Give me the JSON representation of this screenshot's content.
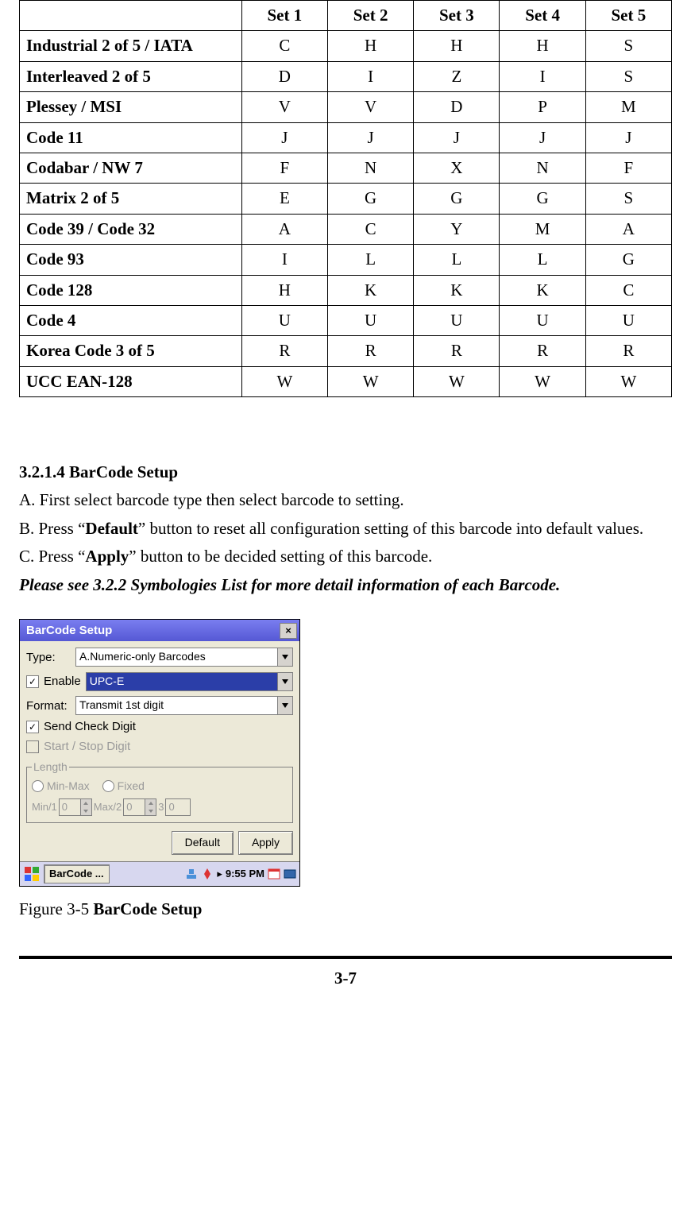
{
  "table": {
    "headers": [
      "",
      "Set 1",
      "Set 2",
      "Set 3",
      "Set 4",
      "Set 5"
    ],
    "rows": [
      {
        "label": "Industrial 2 of 5 / IATA",
        "vals": [
          "C",
          "H",
          "H",
          "H",
          "S"
        ]
      },
      {
        "label": "Interleaved 2 of 5",
        "vals": [
          "D",
          "I",
          "Z",
          "I",
          "S"
        ]
      },
      {
        "label": "Plessey / MSI",
        "vals": [
          "V",
          "V",
          "D",
          "P",
          "M"
        ]
      },
      {
        "label": "Code 11",
        "vals": [
          "J",
          "J",
          "J",
          "J",
          "J"
        ]
      },
      {
        "label": "Codabar / NW 7",
        "vals": [
          "F",
          "N",
          "X",
          "N",
          "F"
        ]
      },
      {
        "label": "Matrix 2 of 5",
        "vals": [
          "E",
          "G",
          "G",
          "G",
          "S"
        ]
      },
      {
        "label": "Code 39 / Code 32",
        "vals": [
          "A",
          "C",
          "Y",
          "M",
          "A"
        ]
      },
      {
        "label": "Code 93",
        "vals": [
          "I",
          "L",
          "L",
          "L",
          "G"
        ]
      },
      {
        "label": "Code 128",
        "vals": [
          "H",
          "K",
          "K",
          "K",
          "C"
        ]
      },
      {
        "label": "Code 4",
        "vals": [
          "U",
          "U",
          "U",
          "U",
          "U"
        ]
      },
      {
        "label": "Korea Code 3 of 5",
        "vals": [
          "R",
          "R",
          "R",
          "R",
          "R"
        ]
      },
      {
        "label": "UCC EAN-128",
        "vals": [
          "W",
          "W",
          "W",
          "W",
          "W"
        ]
      }
    ]
  },
  "section": {
    "heading": "3.2.1.4 BarCode Setup",
    "lineA": "A. First select barcode type then select barcode to setting.",
    "lineB_pre": "B. Press “",
    "lineB_bold": "Default",
    "lineB_post": "” button to reset all configuration setting of this barcode into default values.",
    "lineC_pre": "C. Press “",
    "lineC_bold": "Apply",
    "lineC_post": "” button to be decided setting of this barcode.",
    "note": "Please see 3.2.2 Symbologies List for more detail information of each Barcode."
  },
  "dialog": {
    "title": "BarCode Setup",
    "type_label": "Type:",
    "type_value": "A.Numeric-only Barcodes",
    "enable_label": "Enable",
    "enable_value": "UPC-E",
    "format_label": "Format:",
    "format_value": "Transmit 1st digit",
    "send_check": "Send Check Digit",
    "start_stop": "Start / Stop Digit",
    "length_legend": "Length",
    "radio_minmax": "Min-Max",
    "radio_fixed": "Fixed",
    "min_label": "Min/1",
    "min_val": "0",
    "max_label": "Max/2",
    "max_val": "0",
    "three_label": "3",
    "three_val": "0",
    "btn_default": "Default",
    "btn_apply": "Apply",
    "task_app": "BarCode ...",
    "clock": "9:55 PM"
  },
  "figcap_pre": "Figure 3-5 ",
  "figcap_bold": "BarCode Setup",
  "page_number": "3-7"
}
